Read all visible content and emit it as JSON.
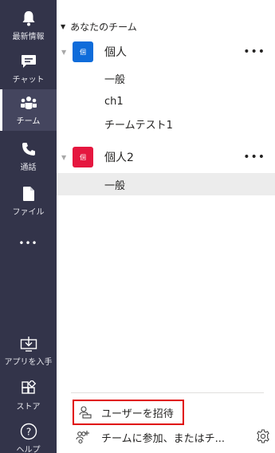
{
  "rail": {
    "items": [
      {
        "label": "最新情報",
        "icon": "bell-icon"
      },
      {
        "label": "チャット",
        "icon": "chat-icon"
      },
      {
        "label": "チーム",
        "icon": "teams-icon"
      },
      {
        "label": "通話",
        "icon": "phone-icon"
      },
      {
        "label": "ファイル",
        "icon": "file-icon"
      },
      {
        "label": "",
        "icon": "more-apps-icon",
        "glyph": "•••"
      },
      {
        "label": "アプリを入手",
        "icon": "get-apps-icon"
      },
      {
        "label": "ストア",
        "icon": "store-icon"
      },
      {
        "label": "ヘルプ",
        "icon": "help-icon"
      }
    ]
  },
  "section": {
    "title": "あなたのチーム",
    "caret": "▼"
  },
  "teams": [
    {
      "name": "個人",
      "avatar_text": "個",
      "avatar_color": "#0f6cda",
      "more": "•••",
      "collapse": "▼",
      "channels": [
        "一般",
        "ch1",
        "チームテスト1"
      ]
    },
    {
      "name": "個人2",
      "avatar_text": "個",
      "avatar_color": "#e5173f",
      "more": "•••",
      "collapse": "▼",
      "channels": [
        "一般"
      ]
    }
  ],
  "footer": {
    "invite_label": "ユーザーを招待",
    "join_label": "チームに参加、またはチ..."
  },
  "colors": {
    "rail_bg": "#33344a",
    "highlight_border": "#e00000",
    "selected_channel_bg": "#ececec"
  }
}
